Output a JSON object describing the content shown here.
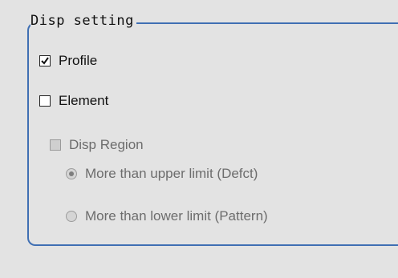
{
  "group": {
    "title": "Disp setting"
  },
  "options": {
    "profile": {
      "label": "Profile",
      "checked": true
    },
    "element": {
      "label": "Element",
      "checked": false
    },
    "disp_region": {
      "label": "Disp Region",
      "checked": false,
      "enabled": false
    }
  },
  "region_mode": {
    "upper": {
      "label": "More than upper limit (Defct)",
      "selected": true
    },
    "lower": {
      "label": "More than lower limit (Pattern)",
      "selected": false
    }
  },
  "colors": {
    "frame": "#3f6fb3",
    "background": "#e3e3e3",
    "disabled_text": "#6d6d6d"
  }
}
